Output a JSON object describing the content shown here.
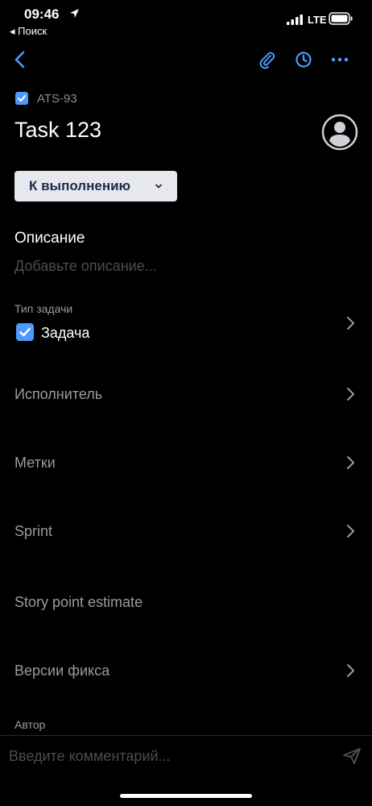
{
  "status_bar": {
    "time": "09:46",
    "back_app": "◂ Поиск",
    "network": "LTE"
  },
  "issue": {
    "key": "ATS-93",
    "title": "Task 123"
  },
  "status_button": {
    "label": "К выполнению"
  },
  "description": {
    "heading": "Описание",
    "placeholder": "Добавьте описание..."
  },
  "issue_type": {
    "label": "Тип задачи",
    "value": "Задача"
  },
  "fields": {
    "assignee": "Исполнитель",
    "labels": "Метки",
    "sprint": "Sprint",
    "story_points": "Story point estimate",
    "fix_versions": "Версии фикса",
    "reporter": "Автор"
  },
  "comment": {
    "placeholder": "Введите комментарий..."
  },
  "colors": {
    "accent": "#4c9aff",
    "background": "#000000",
    "status_bg": "#e6e8ee",
    "status_text": "#1a2b4c"
  },
  "icons": [
    "location-arrow-icon",
    "signal-icon",
    "battery-icon",
    "back-chevron-icon",
    "paperclip-icon",
    "clock-icon",
    "more-icon",
    "checkbox-icon",
    "avatar-icon",
    "chevron-down-icon",
    "chevron-right-icon",
    "send-icon"
  ]
}
